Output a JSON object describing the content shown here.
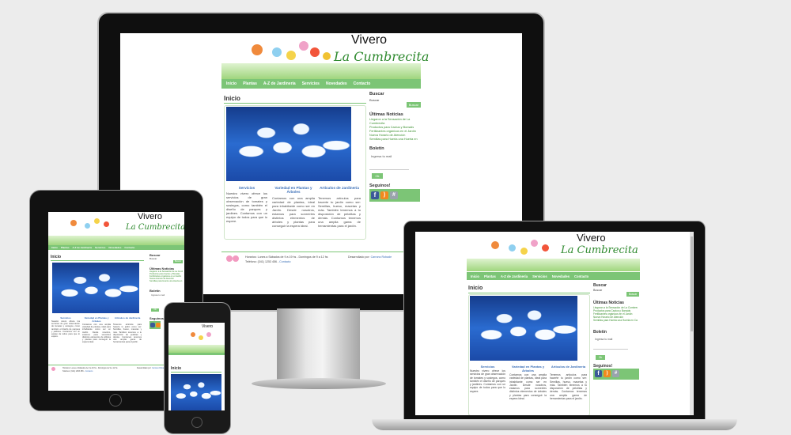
{
  "site": {
    "title": "Vivero",
    "subtitle": "La Cumbrecita",
    "nav": [
      "Inicio",
      "Plantas",
      "A-Z de Jardinería",
      "Servicios",
      "Novedades",
      "Contacto"
    ],
    "page_heading": "Inicio",
    "columns": [
      {
        "title": "Servicios",
        "text": "Nuestro vivero ofrece los servicios de gran observación de tomates y sosiegos, como también el diseño de parques y jardines. Contamos con un equipo de todos para que lo espere."
      },
      {
        "title": "Variedad en Plantas y Árboles",
        "text": "Contamos con una amplia variedad de plantas, ideal para inhabitante como ser en Jardín. Desde nosotros, estamos para sonreírles distintos elementos de árboles y plantas para conseguir la espera ideal."
      },
      {
        "title": "Artículos de Jardinería",
        "text": "Tenemos artículos para hacerte tu jardín como ser: Semillas, hueso, macetas y más. También tenemos a tu disposición de pelotitas y demás. Contamos tenemos una amplia gama de herramientas para el jardín."
      }
    ],
    "sidebar": {
      "search_title": "Buscar",
      "search_placeholder": "Buscar",
      "search_button": "Buscar",
      "news_title": "Últimas Noticias",
      "news": [
        "Llegaron a la Sensación de La Cumbrecita",
        "Productos para Cactus y Bonsáis",
        "Fertilizantes orgánicos en el Jardín",
        "Nueva Horario de Atención",
        "Semillas para Huerta una Huerta en Casa"
      ],
      "newsletter_title": "Boletín",
      "newsletter_placeholder": "Ingresa tu mail",
      "newsletter_button": "Ok",
      "follow_title": "Seguinos!",
      "social_icons": [
        "facebook-icon",
        "rss-icon",
        "other-social-icon"
      ]
    },
    "footer": {
      "hours": "Horarios: Lunes a Sábados de 9 a 19 hs - Domingos de 9 a 12 hs",
      "phone": "Teléfono: (341) 1253 456 - ",
      "contact_link": "Contacto",
      "credit_prefix": "Desarrollado por: ",
      "credit_link": "Carrano Robade"
    }
  },
  "colors": {
    "brand_green": "#7cc576",
    "link_blue": "#3b6fb7",
    "news_green": "#3a8f2e",
    "background": "#ececec"
  }
}
